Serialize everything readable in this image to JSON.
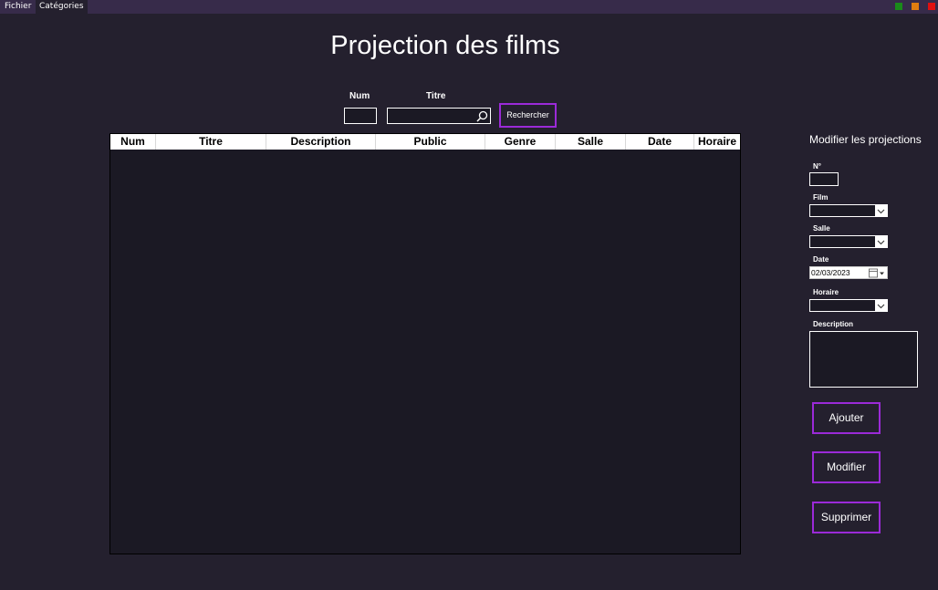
{
  "menu": {
    "file": "Fichier",
    "categories": "Catégories"
  },
  "window_controls": {
    "colors": [
      "#1a8a1a",
      "#e07d10",
      "#e01010"
    ]
  },
  "page_title": "Projection des films",
  "search": {
    "num_label": "Num",
    "titre_label": "Titre",
    "button_label": "Rechercher"
  },
  "table": {
    "columns": [
      "Num",
      "Titre",
      "Description",
      "Public",
      "Genre",
      "Salle",
      "Date",
      "Horaire"
    ],
    "rows": []
  },
  "side_panel": {
    "title": "Modifier les projections",
    "num_label": "N°",
    "film_label": "Film",
    "salle_label": "Salle",
    "date_label": "Date",
    "date_value": "02/03/2023",
    "horaire_label": "Horaire",
    "description_label": "Description",
    "add_label": "Ajouter",
    "modify_label": "Modifier",
    "delete_label": "Supprimer"
  },
  "colors": {
    "background": "#24202e",
    "menubar": "#372b4a",
    "accent": "#9b2ad8",
    "field": "#1b1924"
  }
}
